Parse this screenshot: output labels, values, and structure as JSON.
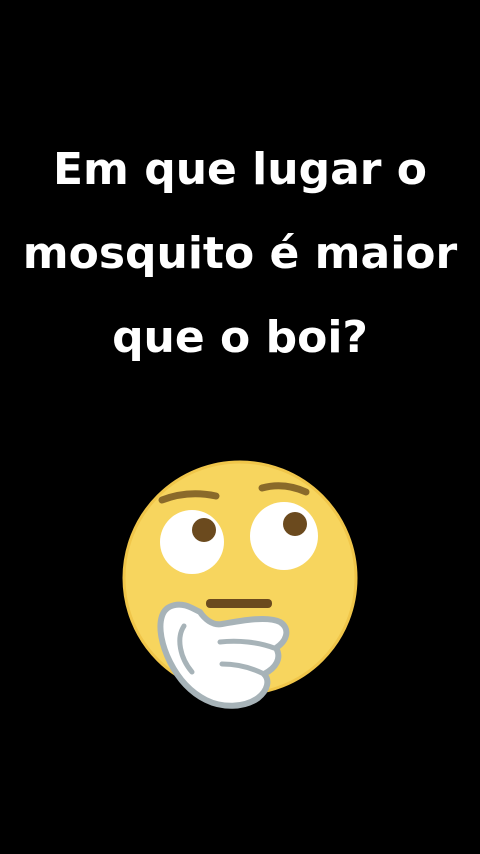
{
  "question": {
    "text": "Em que lugar o mosquito é maior que o boi?"
  },
  "emoji": {
    "icon": "thinking-face-icon",
    "face_color": "#F7D55E",
    "eye_color": "#6B4A1E",
    "hand_color": "#FFFFFF",
    "hand_outline": "#A7B3B8"
  }
}
